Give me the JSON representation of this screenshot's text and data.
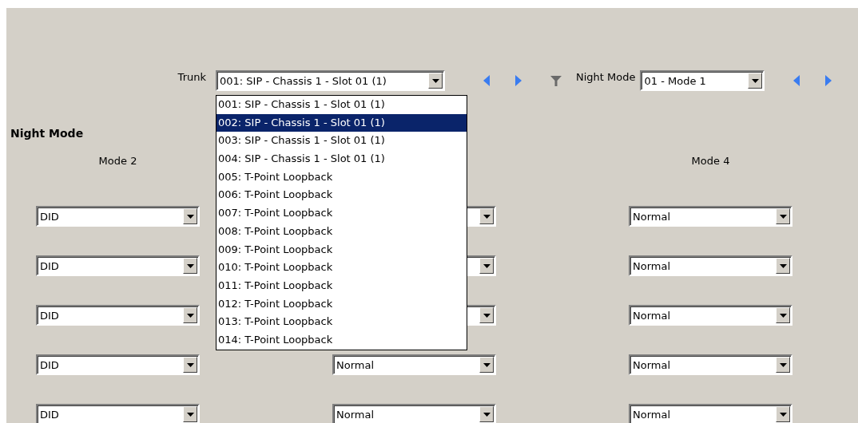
{
  "toolbar": {
    "trunk_label": "Trunk",
    "trunk_value": "001: SIP - Chassis 1 - Slot 01 (1)",
    "night_mode_label": "Night Mode",
    "night_mode_value": "01 - Mode 1"
  },
  "trunk_list": [
    {
      "label": "001: SIP - Chassis 1 - Slot 01 (1)",
      "selected": false
    },
    {
      "label": "002: SIP - Chassis 1 - Slot 01 (1)",
      "selected": true
    },
    {
      "label": "003: SIP - Chassis 1 - Slot 01 (1)",
      "selected": false
    },
    {
      "label": "004: SIP - Chassis 1 - Slot 01 (1)",
      "selected": false
    },
    {
      "label": "005: T-Point Loopback",
      "selected": false
    },
    {
      "label": "006: T-Point Loopback",
      "selected": false
    },
    {
      "label": "007: T-Point Loopback",
      "selected": false
    },
    {
      "label": "008: T-Point Loopback",
      "selected": false
    },
    {
      "label": "009: T-Point Loopback",
      "selected": false
    },
    {
      "label": "010: T-Point Loopback",
      "selected": false
    },
    {
      "label": "011: T-Point Loopback",
      "selected": false
    },
    {
      "label": "012: T-Point Loopback",
      "selected": false
    },
    {
      "label": "013: T-Point Loopback",
      "selected": false
    },
    {
      "label": "014: T-Point Loopback",
      "selected": false
    }
  ],
  "section_title": "Night Mode",
  "columns": [
    {
      "header": "Mode 2",
      "cells": [
        {
          "value": "DID"
        },
        {
          "value": "DID"
        },
        {
          "value": "DID"
        },
        {
          "value": "DID"
        },
        {
          "value": "DID"
        }
      ]
    },
    {
      "cells": [
        {},
        {},
        {},
        {
          "value": "Normal"
        },
        {
          "value": "Normal"
        }
      ]
    },
    {
      "header": "Mode 4",
      "cells": [
        {
          "value": "Normal"
        },
        {
          "value": "Normal"
        },
        {
          "value": "Normal"
        },
        {
          "value": "Normal"
        },
        {
          "value": "Normal"
        }
      ]
    }
  ]
}
